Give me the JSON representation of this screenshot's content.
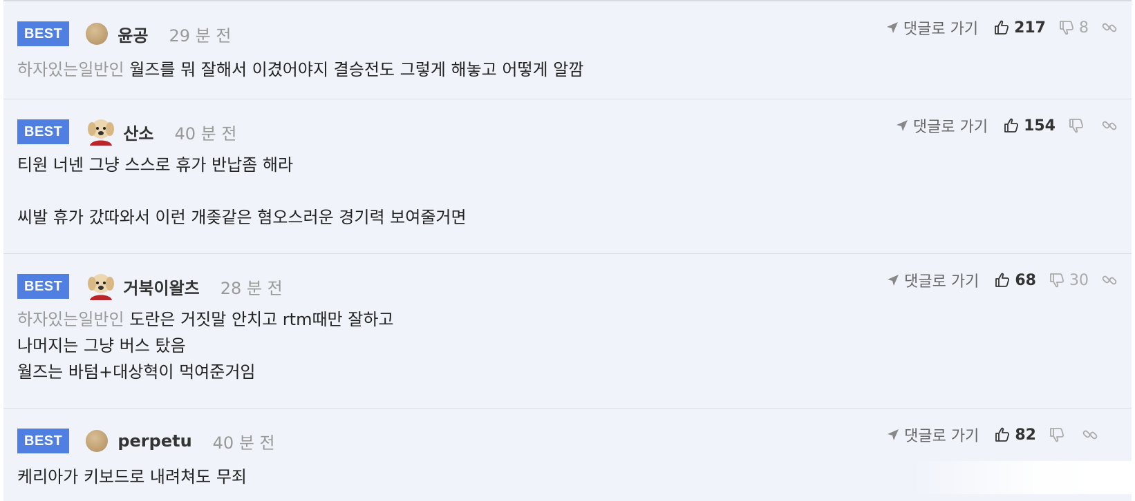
{
  "labels": {
    "best": "BEST",
    "goto_comment": "댓글로 가기"
  },
  "comments": [
    {
      "nick": "윤공",
      "avatar": "brown-dot",
      "time": "29 분 전",
      "likes": "217",
      "dislikes": "8",
      "lines": [
        {
          "mention": "하자있는일반인",
          "text": "월즈를 뭐 잘해서 이겼어야지 결승전도 그렇게 해놓고 어떻게 알깜"
        }
      ]
    },
    {
      "nick": "산소",
      "avatar": "dog",
      "time": "40 분 전",
      "likes": "154",
      "dislikes": "",
      "lines": [
        {
          "text": "티원 너넨 그냥 스스로 휴가 반납좀 해라"
        },
        {
          "text": ""
        },
        {
          "text": "씨발 휴가 갔따와서 이런 개좆같은 혐오스러운 경기력 보여줄거면"
        }
      ]
    },
    {
      "nick": "거북이왈츠",
      "avatar": "dog",
      "time": "28 분 전",
      "likes": "68",
      "dislikes": "30",
      "lines": [
        {
          "mention": "하자있는일반인",
          "text": "도란은 거짓말 안치고 rtm때만 잘하고"
        },
        {
          "text": "나머지는 그냥 버스 탔음"
        },
        {
          "text": "월즈는 바텀+대상혁이 먹여준거임"
        }
      ]
    },
    {
      "nick": "perpetu",
      "avatar": "brown-dot",
      "time": "40 분 전",
      "likes": "82",
      "dislikes": "",
      "lines": [
        {
          "text": "케리아가 키보드로 내려쳐도 무죄"
        }
      ]
    }
  ],
  "icons": {
    "goto": "arrow-icon",
    "like": "thumbs-up-icon",
    "dislike": "thumbs-down-icon",
    "link": "link-icon"
  },
  "colors": {
    "badge": "#4f7fe0",
    "background": "#f0f3fa",
    "mention": "#9a9a9a"
  }
}
